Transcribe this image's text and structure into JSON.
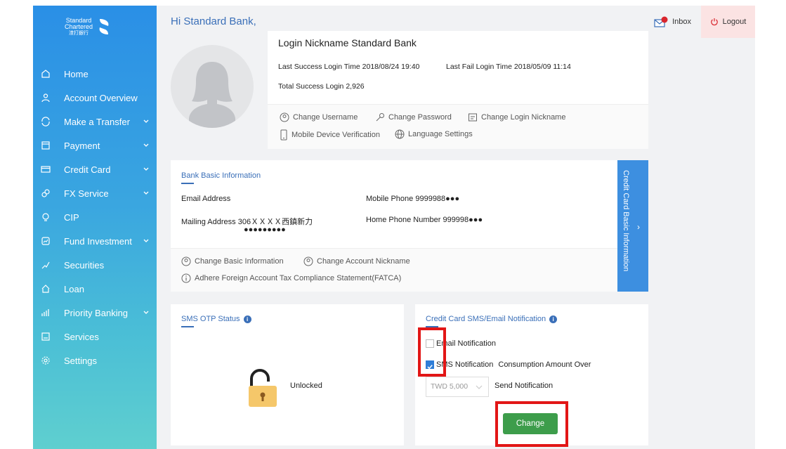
{
  "greeting": "Hi Standard Bank,",
  "header": {
    "inbox_label": "Inbox",
    "logout_label": "Logout"
  },
  "brand": {
    "line1": "Standard",
    "line2": "Chartered",
    "line3": "渣打銀行"
  },
  "sidebar": {
    "items": [
      {
        "label": "Home",
        "icon": "home-icon",
        "chevron": false
      },
      {
        "label": "Account Overview",
        "icon": "person-icon",
        "chevron": false
      },
      {
        "label": "Make a Transfer",
        "icon": "transfer-icon",
        "chevron": true
      },
      {
        "label": "Payment",
        "icon": "payment-icon",
        "chevron": true
      },
      {
        "label": "Credit Card",
        "icon": "credit-card-icon",
        "chevron": true
      },
      {
        "label": "FX Service",
        "icon": "fx-icon",
        "chevron": true
      },
      {
        "label": "CIP",
        "icon": "cip-icon",
        "chevron": false
      },
      {
        "label": "Fund Investment",
        "icon": "fund-icon",
        "chevron": true
      },
      {
        "label": "Securities",
        "icon": "securities-icon",
        "chevron": false
      },
      {
        "label": "Loan",
        "icon": "loan-icon",
        "chevron": false
      },
      {
        "label": "Priority Banking",
        "icon": "priority-icon",
        "chevron": true
      },
      {
        "label": "Services",
        "icon": "services-icon",
        "chevron": false
      },
      {
        "label": "Settings",
        "icon": "gear-icon",
        "chevron": false
      }
    ]
  },
  "profile": {
    "nickname_label": "Login Nickname",
    "nickname_value": "Standard Bank",
    "last_success_label": "Last Success Login Time",
    "last_success_value": "2018/08/24 19:40",
    "last_fail_label": "Last Fail Login Time",
    "last_fail_value": "2018/05/09 11:14",
    "total_label": "Total Success Login",
    "total_value": "2,926",
    "links": {
      "change_username": "Change Username",
      "change_password": "Change Password",
      "change_login_nickname": "Change Login Nickname",
      "mobile_verification": "Mobile Device Verification",
      "language_settings": "Language Settings"
    }
  },
  "basic_info": {
    "title": "Bank Basic Information",
    "email_label": "Email Address",
    "email_value": "",
    "mobile_label": "Mobile Phone",
    "mobile_value": "9999988●●●",
    "mailing_label": "Mailing Address",
    "mailing_value_line1": "306ＸＸＸＸ西鎮新力",
    "mailing_value_line2": "●●●●●●●●●",
    "home_phone_label": "Home Phone Number",
    "home_phone_value": "999998●●●",
    "change_basic": "Change Basic Information",
    "change_account_nickname": "Change Account Nickname",
    "fatca": "Adhere Foreign Account Tax Compliance Statement(FATCA)",
    "side_tab": "Credit Card Basic Information"
  },
  "sms_otp": {
    "title": "SMS OTP Status",
    "status": "Unlocked"
  },
  "cc_notification": {
    "title": "Credit Card SMS/Email Notification",
    "email_label": "Email Notification",
    "email_checked": false,
    "sms_label": "SMS Notification",
    "sms_checked": true,
    "consumption_label": "Consumption Amount Over",
    "amount_selected": "TWD 5,000",
    "send_label": "Send Notification",
    "change_button": "Change"
  },
  "colors": {
    "accent": "#3a6fb8",
    "sidebar_top": "#2a8fe6",
    "sidebar_bottom": "#5fcfcf",
    "button_green": "#3d9d4b",
    "highlight_red": "#e21616"
  }
}
